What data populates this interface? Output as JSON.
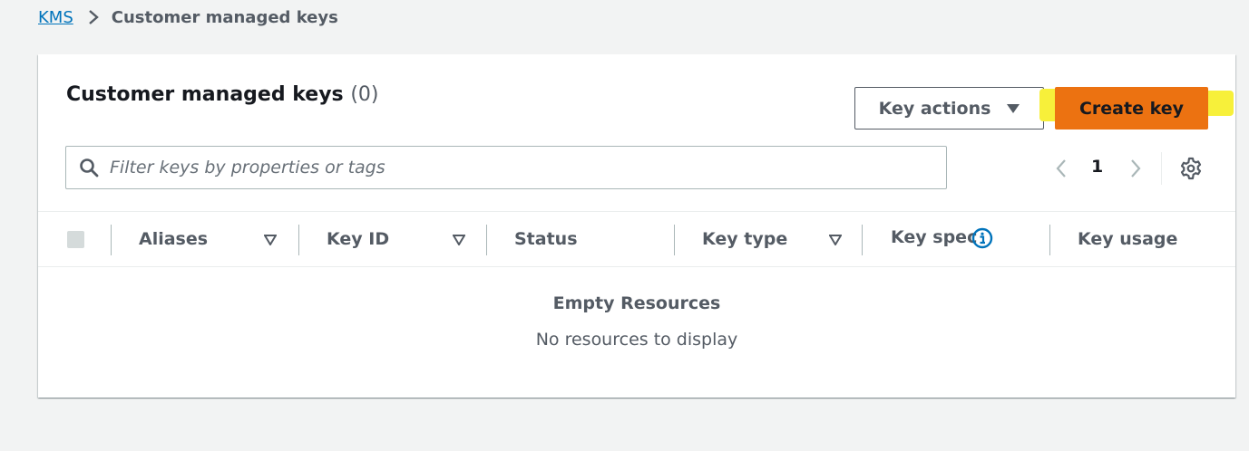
{
  "breadcrumb": {
    "root": "KMS",
    "current": "Customer managed keys"
  },
  "panel": {
    "title": "Customer managed keys",
    "count": "(0)"
  },
  "toolbar": {
    "key_actions_label": "Key actions",
    "create_key_label": "Create key"
  },
  "search": {
    "placeholder": "Filter keys by properties or tags",
    "value": ""
  },
  "pagination": {
    "current_page": "1"
  },
  "table": {
    "columns": [
      {
        "label": "Aliases",
        "sortable": true
      },
      {
        "label": "Key ID",
        "sortable": true
      },
      {
        "label": "Status",
        "sortable": false
      },
      {
        "label": "Key type",
        "sortable": true
      },
      {
        "label": "Key spec",
        "sortable": false,
        "info": true
      },
      {
        "label": "Key usage",
        "sortable": false
      }
    ],
    "empty_title": "Empty Resources",
    "empty_message": "No resources to display"
  },
  "colors": {
    "link": "#0073bb",
    "primary_button": "#ec7211",
    "highlight": "#f7f03a",
    "background": "#f2f3f3"
  },
  "icons": [
    "chevron-right-icon",
    "caret-down-icon",
    "search-icon",
    "chevron-left-icon",
    "settings-gear-icon",
    "sort-icon",
    "info-icon"
  ]
}
